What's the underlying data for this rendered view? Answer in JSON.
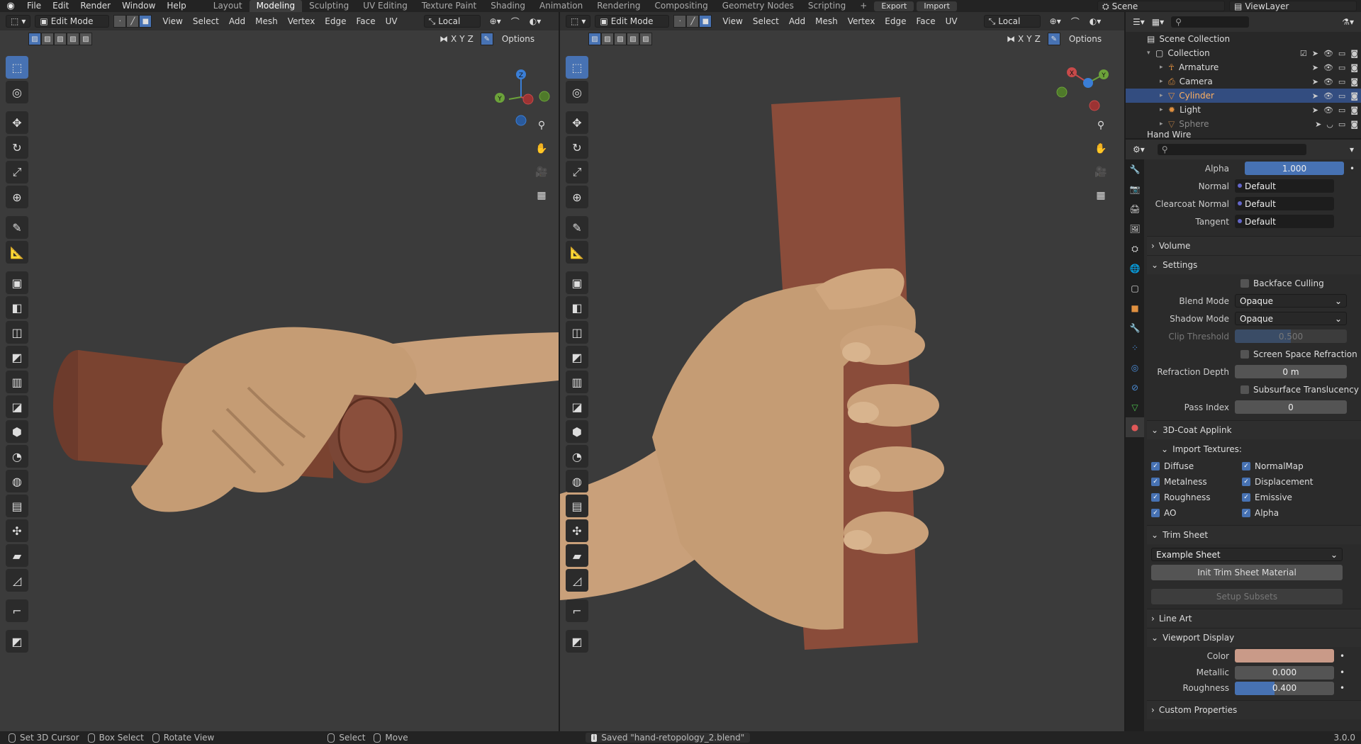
{
  "app": {
    "menus": [
      "File",
      "Edit",
      "Render",
      "Window",
      "Help"
    ],
    "workspaces": [
      "Layout",
      "Modeling",
      "Sculpting",
      "UV Editing",
      "Texture Paint",
      "Shading",
      "Animation",
      "Rendering",
      "Compositing",
      "Geometry Nodes",
      "Scripting"
    ],
    "active_workspace": "Modeling",
    "export_label": "Export",
    "import_label": "Import",
    "scene": "Scene",
    "view_layer": "ViewLayer"
  },
  "viewport": {
    "mode": "Edit Mode",
    "menus": [
      "View",
      "Select",
      "Add",
      "Mesh",
      "Vertex",
      "Edge",
      "Face",
      "UV"
    ],
    "orientation": "Local",
    "options": "Options",
    "axes": [
      "X",
      "Y",
      "Z"
    ]
  },
  "outliner": {
    "scene_collection": "Scene Collection",
    "collection": "Collection",
    "items": [
      "Armature",
      "Camera",
      "Cylinder",
      "Light",
      "Sphere"
    ],
    "selected": "Cylinder",
    "partial": "Hand Wire"
  },
  "props": {
    "alpha_label": "Alpha",
    "alpha_value": "1.000",
    "normal_label": "Normal",
    "normal_value": "Default",
    "clearcoat_label": "Clearcoat Normal",
    "clearcoat_value": "Default",
    "tangent_label": "Tangent",
    "tangent_value": "Default",
    "volume": "Volume",
    "settings": "Settings",
    "backface": "Backface Culling",
    "blend_label": "Blend Mode",
    "blend_value": "Opaque",
    "shadow_label": "Shadow Mode",
    "shadow_value": "Opaque",
    "clip_label": "Clip Threshold",
    "clip_value": "0.500",
    "ssr": "Screen Space Refraction",
    "refr_label": "Refraction Depth",
    "refr_value": "0 m",
    "sss": "Subsurface Translucency",
    "pass_label": "Pass Index",
    "pass_value": "0",
    "applink": "3D-Coat Applink",
    "import_tex": "Import Textures:",
    "tex_left": [
      "Diffuse",
      "Metalness",
      "Roughness",
      "AO"
    ],
    "tex_right": [
      "NormalMap",
      "Displacement",
      "Emissive",
      "Alpha"
    ],
    "trim": "Trim Sheet",
    "trim_value": "Example Sheet",
    "init_trim": "Init Trim Sheet Material",
    "setup_subsets": "Setup Subsets",
    "line_art": "Line Art",
    "viewport_display": "Viewport Display",
    "color_label": "Color",
    "color_hex": "#c99a88",
    "metallic_label": "Metallic",
    "metallic_value": "0.000",
    "roughness_label": "Roughness",
    "roughness_value": "0.400",
    "roughness_fraction": 0.4,
    "custom": "Custom Properties"
  },
  "status": {
    "set_cursor": "Set 3D Cursor",
    "box_select": "Box Select",
    "rotate_view": "Rotate View",
    "select": "Select",
    "move": "Move",
    "saved": "Saved \"hand-retopology_2.blend\"",
    "version": "3.0.0"
  }
}
